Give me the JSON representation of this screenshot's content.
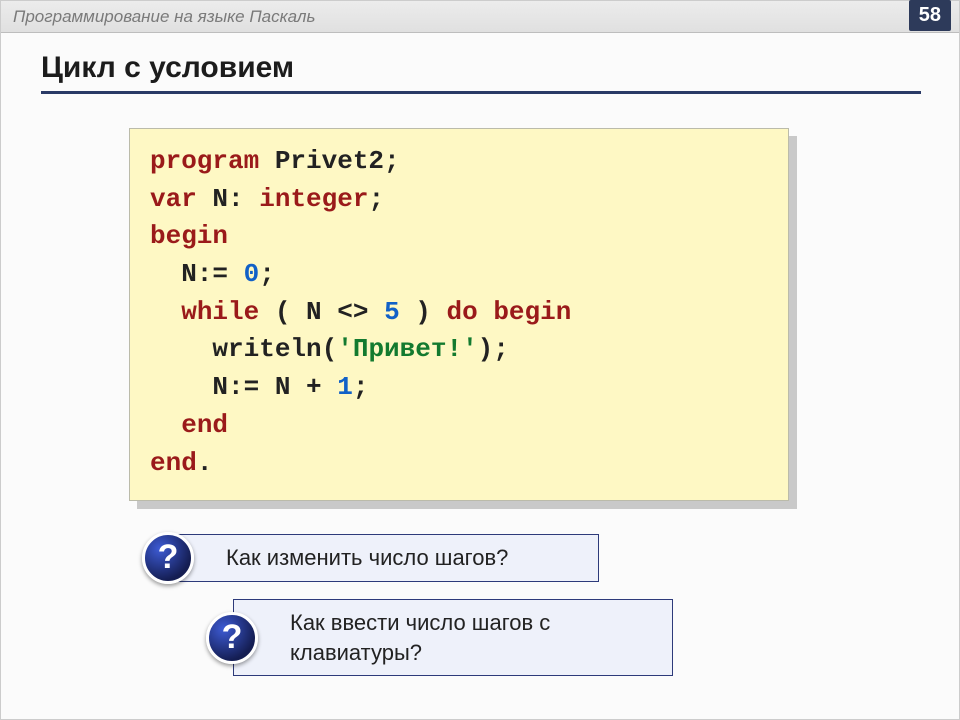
{
  "header": {
    "course": "Программирование на языке Паскаль",
    "page": "58"
  },
  "title": "Цикл с условием",
  "code": {
    "l1": {
      "kw_program": "program",
      "prog_name": " Privet2;"
    },
    "l2": {
      "kw_var": "var",
      "var_decl": " N: ",
      "kw_integer": "integer",
      "semi": ";"
    },
    "l3": {
      "kw_begin": "begin"
    },
    "l4": {
      "assign_a": "  N:= ",
      "num0": "0",
      "semi": ";"
    },
    "l5": {
      "pad": "  ",
      "kw_while": "while",
      "open": " ( N <> ",
      "num5": "5",
      "close": " ) ",
      "kw_do": "do",
      "sp": " ",
      "kw_begin2": "begin"
    },
    "l6": {
      "call_a": "    writeln(",
      "q1": "'",
      "s": "Привет!",
      "q2": "'",
      "call_b": ");"
    },
    "l7": {
      "a": "    N:= N + ",
      "num1": "1",
      "b": ";"
    },
    "l8": {
      "pad": "  ",
      "kw_end": "end"
    },
    "l9": {
      "kw_end": "end",
      "dot": "."
    }
  },
  "questions": {
    "badge": "?",
    "q1": "Как изменить число шагов?",
    "q2": "Как ввести число шагов с клавиатуры?"
  }
}
